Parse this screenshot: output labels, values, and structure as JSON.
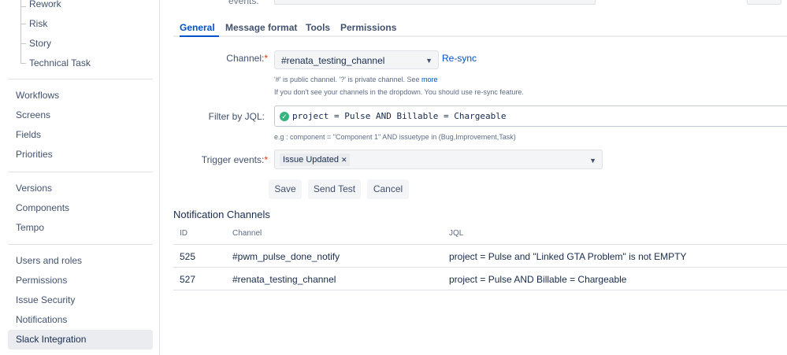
{
  "sidebar": {
    "issue_types": [
      "Rework",
      "Risk",
      "Story",
      "Technical Task"
    ],
    "group1": [
      "Workflows",
      "Screens",
      "Fields",
      "Priorities"
    ],
    "group2": [
      "Versions",
      "Components",
      "Tempo"
    ],
    "group3": [
      "Users and roles",
      "Permissions",
      "Issue Security",
      "Notifications",
      "Slack Integration"
    ],
    "active_item": "Slack Integration"
  },
  "top_partial": {
    "label": "events:"
  },
  "tabs": [
    "General",
    "Message format",
    "Tools",
    "Permissions"
  ],
  "active_tab": "General",
  "form": {
    "channel_label": "Channel:",
    "channel_value": "#renata_testing_channel",
    "resync_label": "Re-sync",
    "channel_help_1": "'#' is public channel. '?' is private channel. See",
    "channel_help_more": "more",
    "channel_help_2": "If you don't see your channels in the dropdown. You should use re-sync feature.",
    "jql_label": "Filter by JQL:",
    "jql_value": "project = Pulse AND Billable = Chargeable",
    "jql_help": "e.g : component = \"Component 1\" AND issuetype in (Bug,Improvement,Task)",
    "trigger_label": "Trigger events:",
    "trigger_chip": "Issue Updated",
    "required_mark": "*",
    "buttons": {
      "save": "Save",
      "send_test": "Send Test",
      "cancel": "Cancel"
    }
  },
  "notification_channels": {
    "title": "Notification Channels",
    "headers": [
      "ID",
      "Channel",
      "JQL"
    ],
    "rows": [
      {
        "id": "525",
        "channel": "#pwm_pulse_done_notify",
        "jql": "project = Pulse and \"Linked GTA Problem\" is not EMPTY"
      },
      {
        "id": "527",
        "channel": "#renata_testing_channel",
        "jql": "project = Pulse AND Billable = Chargeable"
      }
    ]
  },
  "icons": {
    "check": "check-circle-icon",
    "chevron": "chevron-down-icon",
    "remove": "close-icon"
  },
  "colors": {
    "link": "#0052cc",
    "success": "#36b37e",
    "required": "#de350b",
    "active_bg": "#ebecf0"
  }
}
